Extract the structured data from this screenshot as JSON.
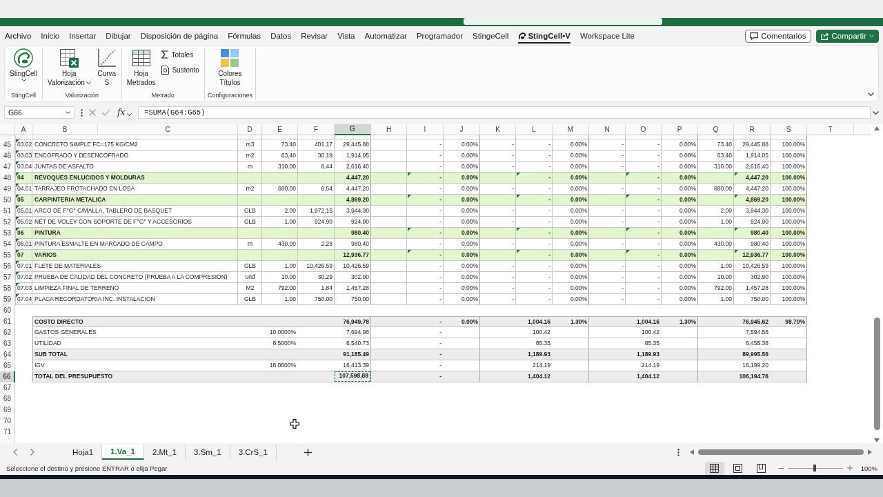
{
  "menu": {
    "tabs": [
      {
        "label": "Archivo",
        "kind": "text",
        "selected": false
      },
      {
        "label": "Inicio",
        "kind": "text",
        "selected": false
      },
      {
        "label": "Insertar",
        "kind": "text",
        "selected": false
      },
      {
        "label": "Dibujar",
        "kind": "text",
        "selected": false
      },
      {
        "label": "Disposición de página",
        "kind": "text",
        "selected": false
      },
      {
        "label": "Fórmulas",
        "kind": "text",
        "selected": false
      },
      {
        "label": "Datos",
        "kind": "text",
        "selected": false
      },
      {
        "label": "Revisar",
        "kind": "text",
        "selected": false
      },
      {
        "label": "Vista",
        "kind": "text",
        "selected": false
      },
      {
        "label": "Automatizar",
        "kind": "text",
        "selected": false
      },
      {
        "label": "Programador",
        "kind": "text",
        "selected": false
      },
      {
        "label": "StingeCell",
        "kind": "text",
        "selected": false
      },
      {
        "label": "StingCell•V",
        "kind": "addin",
        "selected": true
      },
      {
        "label": "Workspace Lite",
        "kind": "text",
        "selected": false
      }
    ],
    "actions": [
      {
        "kind": "comments",
        "label": "Comentarios",
        "dropdown": false
      },
      {
        "kind": "share",
        "label": "Compartir",
        "dropdown": true
      }
    ]
  },
  "ribbon": {
    "groups": [
      {
        "label": "StingCell",
        "buttons": [
          {
            "kind": "logo",
            "lines": [
              "StingCell"
            ],
            "dropdown": true
          }
        ]
      },
      {
        "label": "Valorización",
        "buttons": [
          {
            "kind": "sheet",
            "lines": [
              "Hoja",
              "Valorización"
            ],
            "dropdown": true
          },
          {
            "kind": "curve",
            "lines": [
              "Curva",
              "S"
            ],
            "dropdown": false
          }
        ]
      },
      {
        "label": "Metrado",
        "buttons": [
          {
            "kind": "grid",
            "lines": [
              "Hoja",
              "Metrados"
            ],
            "dropdown": false
          },
          {
            "kind": "sum",
            "lines": [
              "Totales"
            ],
            "dropdown": false
          },
          {
            "kind": "document",
            "lines": [
              "Sustento"
            ],
            "dropdown": false
          }
        ]
      },
      {
        "label": "Configuraciones",
        "buttons": [
          {
            "kind": "palette",
            "lines": [
              "Colores",
              "Títulos"
            ],
            "dropdown": false
          }
        ]
      }
    ]
  },
  "formula_bar": {
    "name_box": "G66",
    "function": "fx",
    "formula": "=SUMA(G64:G65)"
  },
  "sheet": {
    "columns": [
      {
        "label": "A",
        "selected": false
      },
      {
        "label": "B",
        "selected": false
      },
      {
        "label": "C",
        "selected": false
      },
      {
        "label": "D",
        "selected": false
      },
      {
        "label": "E",
        "selected": false
      },
      {
        "label": "F",
        "selected": false
      },
      {
        "label": "G",
        "selected": true
      },
      {
        "label": "H",
        "selected": false
      },
      {
        "label": "I",
        "selected": false
      },
      {
        "label": "J",
        "selected": false
      },
      {
        "label": "K",
        "selected": false
      },
      {
        "label": "L",
        "selected": false
      },
      {
        "label": "M",
        "selected": false
      },
      {
        "label": "N",
        "selected": false
      },
      {
        "label": "O",
        "selected": false
      },
      {
        "label": "P",
        "selected": false
      },
      {
        "label": "Q",
        "selected": false
      },
      {
        "label": "R",
        "selected": false
      },
      {
        "label": "S",
        "selected": false
      },
      {
        "label": "T",
        "selected": false
      }
    ],
    "rows": [
      {
        "number": "45",
        "kind": "item",
        "selected": false,
        "flagged": true,
        "subtotals_flagged": false,
        "copying": false,
        "cells": {
          "col_a": "03.02",
          "col_b": "CONCRETO SIMPLE FC=175 KG/CM2",
          "col_d": "m3",
          "col_e": "73.40",
          "col_f": "401.17",
          "col_g": "29,445.88",
          "col_i": "-",
          "col_j": "0.00%",
          "col_k": "-",
          "col_l": "-",
          "col_m": "0.00%",
          "col_n": "-",
          "col_o": "-",
          "col_p": "0.00%",
          "col_q": "73.40",
          "col_r": "29,445.88",
          "col_s": "100.00%"
        }
      },
      {
        "number": "46",
        "kind": "item",
        "selected": false,
        "flagged": true,
        "subtotals_flagged": false,
        "copying": false,
        "cells": {
          "col_a": "03.03",
          "col_b": "ENCOFRADO Y DESENCOFRADO",
          "col_d": "m2",
          "col_e": "63.40",
          "col_f": "30.19",
          "col_g": "1,914.05",
          "col_i": "-",
          "col_j": "0.00%",
          "col_k": "-",
          "col_l": "-",
          "col_m": "0.00%",
          "col_n": "-",
          "col_o": "-",
          "col_p": "0.00%",
          "col_q": "63.40",
          "col_r": "1,914.05",
          "col_s": "100.00%"
        }
      },
      {
        "number": "47",
        "kind": "item",
        "selected": false,
        "flagged": true,
        "subtotals_flagged": false,
        "copying": false,
        "cells": {
          "col_a": "03.04",
          "col_b": "JUNTAS DE ASFALTO",
          "col_d": "m",
          "col_e": "310.00",
          "col_f": "8.44",
          "col_g": "2,616.40",
          "col_i": "-",
          "col_j": "0.00%",
          "col_k": "-",
          "col_l": "-",
          "col_m": "0.00%",
          "col_n": "-",
          "col_o": "-",
          "col_p": "0.00%",
          "col_q": "310.00",
          "col_r": "2,616.40",
          "col_s": "100.00%"
        }
      },
      {
        "number": "48",
        "kind": "section",
        "selected": false,
        "flagged": true,
        "subtotals_flagged": true,
        "copying": false,
        "cells": {
          "col_a": "04",
          "col_b": "REVOQUES ENLUCIDOS Y MOLDURAS",
          "col_g": "4,447.20",
          "col_i": "-",
          "col_j": "0.00%",
          "col_l": "-",
          "col_m": "0.00%",
          "col_o": "-",
          "col_p": "0.00%",
          "col_r": "4,447.20",
          "col_s": "100.00%"
        }
      },
      {
        "number": "49",
        "kind": "item",
        "selected": false,
        "flagged": true,
        "subtotals_flagged": false,
        "copying": false,
        "cells": {
          "col_a": "04.01",
          "col_b": "TARRAJEO FROTACHADO EN LOSA",
          "col_d": "m2",
          "col_e": "680.00",
          "col_f": "6.54",
          "col_g": "4,447.20",
          "col_i": "-",
          "col_j": "0.00%",
          "col_k": "-",
          "col_l": "-",
          "col_m": "0.00%",
          "col_n": "-",
          "col_o": "-",
          "col_p": "0.00%",
          "col_q": "680.00",
          "col_r": "4,447.20",
          "col_s": "100.00%"
        }
      },
      {
        "number": "50",
        "kind": "section",
        "selected": false,
        "flagged": true,
        "subtotals_flagged": true,
        "copying": false,
        "cells": {
          "col_a": "05",
          "col_b": "CARPINTERIA METALICA",
          "col_g": "4,869.20",
          "col_i": "-",
          "col_j": "0.00%",
          "col_l": "-",
          "col_m": "0.00%",
          "col_o": "-",
          "col_p": "0.00%",
          "col_r": "4,869.20",
          "col_s": "100.00%"
        }
      },
      {
        "number": "51",
        "kind": "item",
        "selected": false,
        "flagged": true,
        "subtotals_flagged": false,
        "copying": false,
        "cells": {
          "col_a": "05.01",
          "col_b": "ARCO DE F°G° C/MALLA, TABLERO DE BASQUET",
          "col_d": "GLB",
          "col_e": "2.00",
          "col_f": "1,972.15",
          "col_g": "3,944.30",
          "col_i": "-",
          "col_j": "0.00%",
          "col_k": "-",
          "col_l": "-",
          "col_m": "0.00%",
          "col_n": "-",
          "col_o": "-",
          "col_p": "0.00%",
          "col_q": "2.00",
          "col_r": "3,944.30",
          "col_s": "100.00%"
        }
      },
      {
        "number": "52",
        "kind": "item",
        "selected": false,
        "flagged": true,
        "subtotals_flagged": false,
        "copying": false,
        "cells": {
          "col_a": "05.02",
          "col_b": "NET DE VOLEY CON SOPORTE DE F°G° Y ACCESORIOS",
          "col_d": "GLB",
          "col_e": "1.00",
          "col_f": "924.90",
          "col_g": "924.90",
          "col_i": "-",
          "col_j": "0.00%",
          "col_k": "-",
          "col_l": "-",
          "col_m": "0.00%",
          "col_n": "-",
          "col_o": "-",
          "col_p": "0.00%",
          "col_q": "1.00",
          "col_r": "924.90",
          "col_s": "100.00%"
        }
      },
      {
        "number": "53",
        "kind": "section",
        "selected": false,
        "flagged": true,
        "subtotals_flagged": true,
        "copying": false,
        "cells": {
          "col_a": "06",
          "col_b": "PINTURA",
          "col_g": "980.40",
          "col_i": "-",
          "col_j": "0.00%",
          "col_l": "-",
          "col_m": "0.00%",
          "col_o": "-",
          "col_p": "0.00%",
          "col_r": "980.40",
          "col_s": "100.00%"
        }
      },
      {
        "number": "54",
        "kind": "item",
        "selected": false,
        "flagged": true,
        "subtotals_flagged": false,
        "copying": false,
        "cells": {
          "col_a": "06.01",
          "col_b": "PINTURA ESMALTE EN MARCADO DE CAMPO",
          "col_d": "m",
          "col_e": "430.00",
          "col_f": "2.28",
          "col_g": "980.40",
          "col_i": "-",
          "col_j": "0.00%",
          "col_k": "-",
          "col_l": "-",
          "col_m": "0.00%",
          "col_n": "-",
          "col_o": "-",
          "col_p": "0.00%",
          "col_q": "430.00",
          "col_r": "980.40",
          "col_s": "100.00%"
        }
      },
      {
        "number": "55",
        "kind": "section",
        "selected": false,
        "flagged": true,
        "subtotals_flagged": true,
        "copying": false,
        "cells": {
          "col_a": "07",
          "col_b": "VARIOS",
          "col_g": "12,936.77",
          "col_i": "-",
          "col_j": "0.00%",
          "col_l": "-",
          "col_m": "0.00%",
          "col_o": "-",
          "col_p": "0.00%",
          "col_r": "12,936.77",
          "col_s": "100.00%"
        }
      },
      {
        "number": "56",
        "kind": "item",
        "selected": false,
        "flagged": true,
        "subtotals_flagged": false,
        "copying": false,
        "cells": {
          "col_a": "07.01",
          "col_b": "FLETE DE MATERIALES",
          "col_d": "GLB",
          "col_e": "1.00",
          "col_f": "10,426.59",
          "col_g": "10,426.59",
          "col_i": "-",
          "col_j": "0.00%",
          "col_k": "-",
          "col_l": "-",
          "col_m": "0.00%",
          "col_n": "-",
          "col_o": "-",
          "col_p": "0.00%",
          "col_q": "1.00",
          "col_r": "10,426.59",
          "col_s": "100.00%"
        }
      },
      {
        "number": "57",
        "kind": "item",
        "selected": false,
        "flagged": true,
        "subtotals_flagged": false,
        "copying": false,
        "cells": {
          "col_a": "07.02",
          "col_b": "PRUEBA DE CALIDAD DEL CONCRETO (PRUEBA A LA COMPRESION)",
          "col_d": "und",
          "col_e": "10.00",
          "col_f": "30.29",
          "col_g": "302.90",
          "col_i": "-",
          "col_j": "0.00%",
          "col_k": "-",
          "col_l": "-",
          "col_m": "0.00%",
          "col_n": "-",
          "col_o": "-",
          "col_p": "0.00%",
          "col_q": "10.00",
          "col_r": "302.90",
          "col_s": "100.00%"
        }
      },
      {
        "number": "58",
        "kind": "item",
        "selected": false,
        "flagged": true,
        "subtotals_flagged": false,
        "copying": false,
        "cells": {
          "col_a": "07.03",
          "col_b": "LIMPIEZA FINAL DE TERRENO",
          "col_d": "M2",
          "col_e": "792.00",
          "col_f": "1.84",
          "col_g": "1,457.28",
          "col_i": "-",
          "col_j": "0.00%",
          "col_k": "-",
          "col_l": "-",
          "col_m": "0.00%",
          "col_n": "-",
          "col_o": "-",
          "col_p": "0.00%",
          "col_q": "792.00",
          "col_r": "1,457.28",
          "col_s": "100.00%"
        }
      },
      {
        "number": "59",
        "kind": "item",
        "selected": false,
        "flagged": true,
        "subtotals_flagged": false,
        "copying": false,
        "cells": {
          "col_a": "07.04",
          "col_b": "PLACA RECORDATORIA INC. INSTALACION",
          "col_d": "GLB",
          "col_e": "1.00",
          "col_f": "750.00",
          "col_g": "750.00",
          "col_i": "-",
          "col_j": "0.00%",
          "col_k": "-",
          "col_l": "-",
          "col_m": "0.00%",
          "col_n": "-",
          "col_o": "-",
          "col_p": "0.00%",
          "col_q": "1.00",
          "col_r": "750.00",
          "col_s": "100.00%"
        }
      },
      {
        "number": "60",
        "kind": "blank",
        "selected": false
      },
      {
        "number": "61",
        "kind": "total",
        "selected": false,
        "copying": false,
        "cells": {
          "col_b": "COSTO DIRECTO",
          "col_g": "76,949.78",
          "col_i": "-",
          "col_j": "0.00%",
          "col_l": "1,004.16",
          "col_m": "1.30%",
          "col_o": "1,004.16",
          "col_p": "1.30%",
          "col_r": "76,945.62",
          "col_s": "98.70%"
        }
      },
      {
        "number": "62",
        "kind": "line",
        "selected": false,
        "copying": false,
        "cells": {
          "col_b": "GASTOS GENERALES",
          "col_e": "10.0000%",
          "col_g": "7,694.98",
          "col_i": "-",
          "col_l": "100.42",
          "col_o": "100.42",
          "col_r": "7,594.56"
        }
      },
      {
        "number": "63",
        "kind": "line",
        "selected": false,
        "copying": false,
        "cells": {
          "col_b": "UTILIDAD",
          "col_e": "8.5000%",
          "col_g": "6,540.73",
          "col_i": "-",
          "col_l": "85.35",
          "col_o": "85.35",
          "col_r": "6,455.38"
        }
      },
      {
        "number": "64",
        "kind": "total",
        "selected": false,
        "copying": false,
        "cells": {
          "col_b": "SUB TOTAL",
          "col_g": "91,185.49",
          "col_i": "-",
          "col_l": "1,189.93",
          "col_o": "1,189.93",
          "col_r": "89,995.56"
        }
      },
      {
        "number": "65",
        "kind": "line",
        "selected": false,
        "copying": false,
        "cells": {
          "col_b": "IGV",
          "col_e": "18.0000%",
          "col_g": "16,413.39",
          "col_i": "-",
          "col_l": "214.19",
          "col_o": "214.19",
          "col_r": "16,199.20"
        }
      },
      {
        "number": "66",
        "kind": "total",
        "selected": true,
        "copying": true,
        "cells": {
          "col_b": "TOTAL DEL PRESUPUESTO",
          "col_g": "107,598.88",
          "col_i": "-",
          "col_l": "1,404.12",
          "col_o": "1,404.12",
          "col_r": "106,194.76"
        }
      },
      {
        "number": "67",
        "kind": "blank",
        "selected": false
      },
      {
        "number": "68",
        "kind": "blank",
        "selected": false
      },
      {
        "number": "69",
        "kind": "blank",
        "selected": false
      },
      {
        "number": "70",
        "kind": "blank",
        "selected": false
      },
      {
        "number": "71",
        "kind": "blank",
        "selected": false
      }
    ]
  },
  "sheet_tabs": [
    {
      "label": "Hoja1",
      "selected": false
    },
    {
      "label": "1.Va_1",
      "selected": true
    },
    {
      "label": "2.Mt_1",
      "selected": false
    },
    {
      "label": "3.Sm_1",
      "selected": false
    },
    {
      "label": "3.CrS_1",
      "selected": false
    }
  ],
  "status_bar": {
    "message": "Seleccione el destino y presione ENTRAR o elija Pegar",
    "views": [
      {
        "kind": "normal",
        "selected": true
      },
      {
        "kind": "page_layout",
        "selected": false
      },
      {
        "kind": "page_break",
        "selected": false
      }
    ],
    "zoom": {
      "level": 0.49,
      "label": "100%"
    }
  }
}
